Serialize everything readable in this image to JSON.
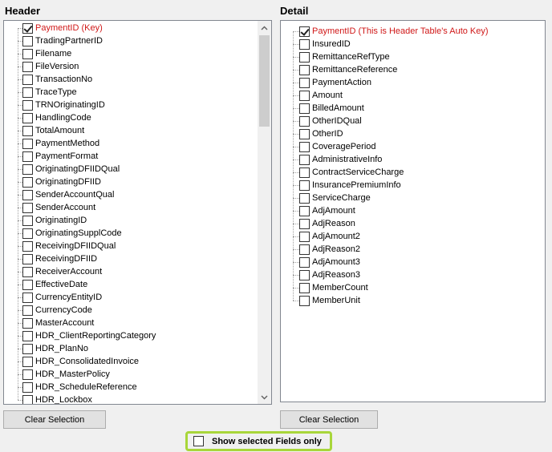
{
  "header_section": {
    "title": "Header",
    "fields": [
      {
        "label": "PaymentID (Key)",
        "checked": true,
        "key": true
      },
      {
        "label": "TradingPartnerID",
        "checked": false
      },
      {
        "label": "Filename",
        "checked": false
      },
      {
        "label": "FileVersion",
        "checked": false
      },
      {
        "label": "TransactionNo",
        "checked": false
      },
      {
        "label": "TraceType",
        "checked": false
      },
      {
        "label": "TRNOriginatingID",
        "checked": false
      },
      {
        "label": "HandlingCode",
        "checked": false
      },
      {
        "label": "TotalAmount",
        "checked": false
      },
      {
        "label": "PaymentMethod",
        "checked": false
      },
      {
        "label": "PaymentFormat",
        "checked": false
      },
      {
        "label": "OriginatingDFIIDQual",
        "checked": false
      },
      {
        "label": "OriginatingDFIID",
        "checked": false
      },
      {
        "label": "SenderAccountQual",
        "checked": false
      },
      {
        "label": "SenderAccount",
        "checked": false
      },
      {
        "label": "OriginatingID",
        "checked": false
      },
      {
        "label": "OriginatingSupplCode",
        "checked": false
      },
      {
        "label": "ReceivingDFIIDQual",
        "checked": false
      },
      {
        "label": "ReceivingDFIID",
        "checked": false
      },
      {
        "label": "ReceiverAccount",
        "checked": false
      },
      {
        "label": "EffectiveDate",
        "checked": false
      },
      {
        "label": "CurrencyEntityID",
        "checked": false
      },
      {
        "label": "CurrencyCode",
        "checked": false
      },
      {
        "label": "MasterAccount",
        "checked": false
      },
      {
        "label": "HDR_ClientReportingCategory",
        "checked": false
      },
      {
        "label": "HDR_PlanNo",
        "checked": false
      },
      {
        "label": "HDR_ConsolidatedInvoice",
        "checked": false
      },
      {
        "label": "HDR_MasterPolicy",
        "checked": false
      },
      {
        "label": "HDR_ScheduleReference",
        "checked": false
      },
      {
        "label": "HDR_Lockbox",
        "checked": false
      }
    ],
    "clear_label": "Clear Selection"
  },
  "detail_section": {
    "title": "Detail",
    "fields": [
      {
        "label": "PaymentID (This is Header Table's Auto Key)",
        "checked": true,
        "key": true
      },
      {
        "label": "InsuredID",
        "checked": false
      },
      {
        "label": "RemittanceRefType",
        "checked": false
      },
      {
        "label": "RemittanceReference",
        "checked": false
      },
      {
        "label": "PaymentAction",
        "checked": false
      },
      {
        "label": "Amount",
        "checked": false
      },
      {
        "label": "BilledAmount",
        "checked": false
      },
      {
        "label": "OtherIDQual",
        "checked": false
      },
      {
        "label": "OtherID",
        "checked": false
      },
      {
        "label": "CoveragePeriod",
        "checked": false
      },
      {
        "label": "AdministrativeInfo",
        "checked": false
      },
      {
        "label": "ContractServiceCharge",
        "checked": false
      },
      {
        "label": "InsurancePremiumInfo",
        "checked": false
      },
      {
        "label": "ServiceCharge",
        "checked": false
      },
      {
        "label": "AdjAmount",
        "checked": false
      },
      {
        "label": "AdjReason",
        "checked": false
      },
      {
        "label": "AdjAmount2",
        "checked": false
      },
      {
        "label": "AdjReason2",
        "checked": false
      },
      {
        "label": "AdjAmount3",
        "checked": false
      },
      {
        "label": "AdjReason3",
        "checked": false
      },
      {
        "label": "MemberCount",
        "checked": false
      },
      {
        "label": "MemberUnit",
        "checked": false
      }
    ],
    "clear_label": "Clear Selection"
  },
  "show_selected": {
    "label": "Show selected Fields only",
    "checked": false
  },
  "colors": {
    "key_field": "#d01818",
    "highlight_border": "#a8d63a"
  },
  "icons": {
    "scroll_up": "chevron-up-icon",
    "scroll_down": "chevron-down-icon"
  }
}
